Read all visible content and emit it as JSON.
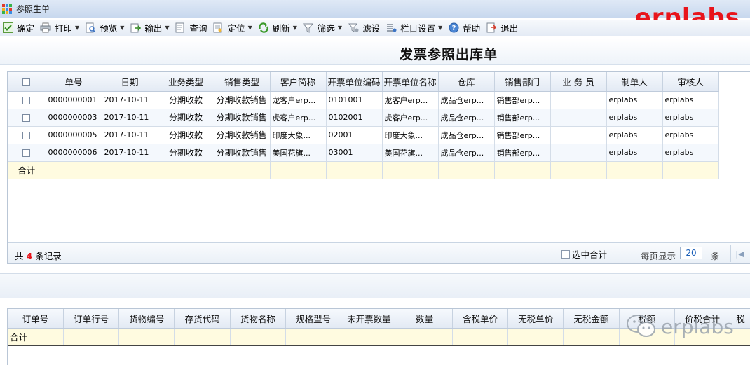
{
  "window": {
    "title": "参照生单"
  },
  "brand": {
    "text": "erplabs",
    "color": "#e8141b"
  },
  "toolbar": {
    "items": [
      {
        "label": "确定",
        "icon": "check-icon"
      },
      {
        "label": "打印",
        "icon": "printer-icon",
        "dropdown": true
      },
      {
        "label": "预览",
        "icon": "preview-icon",
        "dropdown": true
      },
      {
        "label": "输出",
        "icon": "export-icon",
        "dropdown": true
      },
      {
        "label": "查询",
        "icon": "query-icon"
      },
      {
        "label": "定位",
        "icon": "locate-icon",
        "dropdown": true
      },
      {
        "label": "刷新",
        "icon": "refresh-icon",
        "dropdown": true
      },
      {
        "label": "筛选",
        "icon": "filter-icon",
        "dropdown": true
      },
      {
        "label": "滤设",
        "icon": "filter-settings-icon"
      },
      {
        "label": "栏目设置",
        "icon": "columns-settings-icon",
        "dropdown": true
      },
      {
        "label": "帮助",
        "icon": "help-icon"
      },
      {
        "label": "退出",
        "icon": "exit-icon"
      }
    ]
  },
  "page": {
    "title": "发票参照出库单"
  },
  "upper_grid": {
    "columns": [
      "单号",
      "日期",
      "业务类型",
      "销售类型",
      "客户简称",
      "开票单位编码",
      "开票单位名称",
      "仓库",
      "销售部门",
      "业 务 员",
      "制单人",
      "审核人"
    ],
    "rows": [
      [
        "0000000001",
        "2017-10-11",
        "分期收款",
        "分期收款销售",
        "龙客户erp...",
        "0101001",
        "龙客户erp...",
        "成品仓erp...",
        "销售部erp...",
        "",
        "erplabs",
        "erplabs"
      ],
      [
        "0000000003",
        "2017-10-11",
        "分期收款",
        "分期收款销售",
        "虎客户erp...",
        "0102001",
        "虎客户erp...",
        "成品仓erp...",
        "销售部erp...",
        "",
        "erplabs",
        "erplabs"
      ],
      [
        "0000000005",
        "2017-10-11",
        "分期收款",
        "分期收款销售",
        "印度大象...",
        "02001",
        "印度大象...",
        "成品仓erp...",
        "销售部erp...",
        "",
        "erplabs",
        "erplabs"
      ],
      [
        "0000000006",
        "2017-10-11",
        "分期收款",
        "分期收款销售",
        "美国花旗...",
        "03001",
        "美国花旗...",
        "成品仓erp...",
        "销售部erp...",
        "",
        "erplabs",
        "erplabs"
      ]
    ],
    "sum_label": "合计"
  },
  "pager": {
    "total_prefix": "共",
    "total_count": "4",
    "total_suffix": "条记录",
    "selected_sum_label": "选中合计",
    "per_page_label": "每页显示",
    "page_size": "20",
    "unit": "条"
  },
  "lower_grid": {
    "columns": [
      "订单号",
      "订单行号",
      "货物编号",
      "存货代码",
      "货物名称",
      "规格型号",
      "未开票数量",
      "数量",
      "含税单价",
      "无税单价",
      "无税金额",
      "税额",
      "价税合计",
      "税"
    ],
    "sum_label": "合计"
  },
  "watermark": {
    "text": "erplabs"
  }
}
